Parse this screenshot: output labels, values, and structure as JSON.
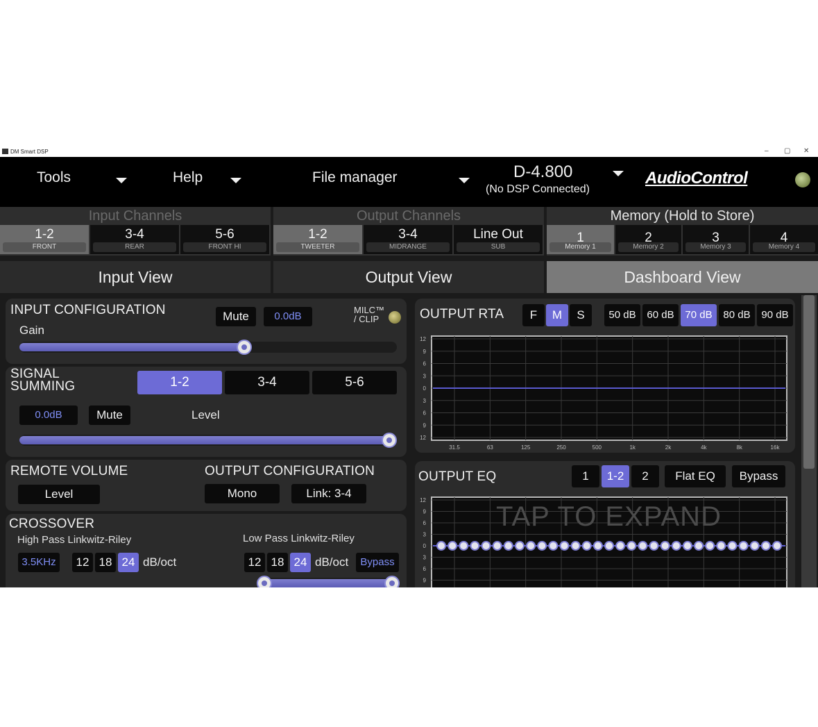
{
  "window": {
    "title": "DM Smart DSP",
    "minimize": "–",
    "maximize": "▢",
    "close": "✕"
  },
  "menubar": {
    "tools": "Tools",
    "help": "Help",
    "file_manager": "File manager",
    "device": "D-4.800",
    "device_status": "(No DSP Connected)",
    "logo": "AudioControl"
  },
  "input_channels": {
    "title": "Input Channels",
    "buttons": [
      {
        "label": "1-2",
        "sub": "FRONT"
      },
      {
        "label": "3-4",
        "sub": "REAR"
      },
      {
        "label": "5-6",
        "sub": "FRONT HI"
      }
    ],
    "selected": "1-2"
  },
  "output_channels": {
    "title": "Output Channels",
    "buttons": [
      {
        "label": "1-2",
        "sub": "TWEETER"
      },
      {
        "label": "3-4",
        "sub": "MIDRANGE"
      },
      {
        "label": "Line Out",
        "sub": "SUB"
      }
    ],
    "selected": "1-2"
  },
  "memory": {
    "title": "Memory (Hold to Store)",
    "buttons": [
      {
        "label": "1",
        "sub": "Memory 1"
      },
      {
        "label": "2",
        "sub": "Memory 2"
      },
      {
        "label": "3",
        "sub": "Memory 3"
      },
      {
        "label": "4",
        "sub": "Memory 4"
      }
    ],
    "selected": "1"
  },
  "views": {
    "input": "Input View",
    "output": "Output View",
    "dashboard": "Dashboard View",
    "active": "dashboard"
  },
  "input_config": {
    "title": "INPUT CONFIGURATION",
    "gain_label": "Gain",
    "mute": "Mute",
    "value": "0.0dB",
    "milc_line1": "MILC™",
    "milc_line2": "/ CLIP",
    "gain_level": 0.6
  },
  "signal_summing": {
    "title_line1": "SIGNAL",
    "title_line2": "SUMMING",
    "tabs": [
      "1-2",
      "3-4",
      "5-6"
    ],
    "selected": "1-2",
    "value": "0.0dB",
    "mute": "Mute",
    "level_label": "Level",
    "level": 1.0
  },
  "remote_volume": {
    "title": "REMOTE VOLUME",
    "button": "Level"
  },
  "output_config": {
    "title": "OUTPUT CONFIGURATION",
    "mono": "Mono",
    "link": "Link: 3-4"
  },
  "crossover": {
    "title": "CROSSOVER",
    "high_pass": {
      "label": "High Pass Linkwitz-Riley",
      "freq": "3.5KHz",
      "slopes": [
        "12",
        "18",
        "24"
      ],
      "selected": "24",
      "unit": "dB/oct"
    },
    "low_pass": {
      "label": "Low Pass Linkwitz-Riley",
      "slopes": [
        "12",
        "18",
        "24"
      ],
      "selected": "24",
      "unit": "dB/oct",
      "bypass": "Bypass"
    }
  },
  "output_rta": {
    "title": "OUTPUT RTA",
    "modes": [
      "F",
      "M",
      "S"
    ],
    "mode_selected": "M",
    "ranges": [
      "50 dB",
      "60 dB",
      "70 dB",
      "80 dB",
      "90 dB"
    ],
    "range_selected": "70 dB",
    "y_ticks": [
      "12",
      "9",
      "6",
      "3",
      "0",
      "3",
      "6",
      "9",
      "12"
    ],
    "x_ticks": [
      "31.5",
      "63",
      "125",
      "250",
      "500",
      "1k",
      "2k",
      "4k",
      "8k",
      "16k"
    ],
    "line_color": "#5a5ad0"
  },
  "output_eq": {
    "title": "OUTPUT EQ",
    "channels": [
      "1",
      "1-2",
      "2"
    ],
    "channel_selected": "1-2",
    "flat": "Flat EQ",
    "bypass": "Bypass",
    "y_ticks": [
      "12",
      "9",
      "6",
      "3",
      "0",
      "3",
      "6",
      "9"
    ],
    "bands": 31,
    "band_gain_db": 0,
    "watermark": "TAP TO EXPAND"
  },
  "colors": {
    "accent": "#6d6bd6",
    "accent_text": "#7f8ef5",
    "background": "#1b1b1b",
    "panel": "#2b2b2b"
  }
}
